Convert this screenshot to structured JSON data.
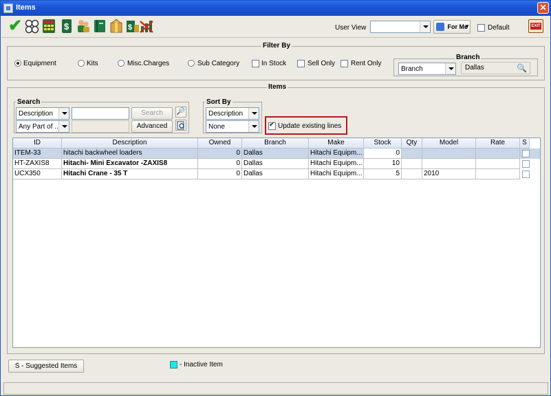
{
  "window": {
    "title": "Items"
  },
  "toolbar": {
    "icons": [
      "accept-icon",
      "kits-icon",
      "calculator-icon",
      "price-icon",
      "users-icon",
      "book-icon",
      "package-icon",
      "building-icon",
      "chart-icon"
    ],
    "user_view_label": "User View",
    "user_view_value": "",
    "for_me_label": "For Me",
    "default_label": "Default",
    "exit_label": "EXIT"
  },
  "filter": {
    "title": "Filter By",
    "options": [
      {
        "label": "Equipment",
        "type": "radio",
        "checked": true
      },
      {
        "label": "Kits",
        "type": "radio",
        "checked": false
      },
      {
        "label": "Misc.Charges",
        "type": "radio",
        "checked": false
      },
      {
        "label": "Sub Category",
        "type": "radio",
        "checked": false
      },
      {
        "label": "In Stock",
        "type": "check",
        "checked": false
      },
      {
        "label": "Sell Only",
        "type": "check",
        "checked": false
      },
      {
        "label": "Rent Only",
        "type": "check",
        "checked": false
      }
    ],
    "branch_title": "Branch",
    "branch_select": "Branch",
    "branch_value": "Dallas"
  },
  "items_panel": {
    "title": "Items"
  },
  "search": {
    "title": "Search",
    "field_select": "Description",
    "match_select": "Any Part of ...",
    "input_value": "",
    "search_button": "Search",
    "advanced_button": "Advanced"
  },
  "sort": {
    "title": "Sort By",
    "primary": "Description",
    "secondary": "None"
  },
  "update_existing_label": "Update existing lines",
  "table": {
    "columns": [
      "ID",
      "Description",
      "Owned",
      "Branch",
      "Make",
      "Stock",
      "Qty",
      "Model",
      "Rate",
      "S"
    ],
    "rows": [
      {
        "id": "ITEM-33",
        "description": "hitachi backwheel loaders",
        "owned": "0",
        "branch": "Dallas",
        "make": "Hitachi Equipm...",
        "stock": "0",
        "qty": "",
        "model": "",
        "rate": "",
        "selected": true,
        "bold": false
      },
      {
        "id": "HT-ZAXIS8",
        "description": "Hitachi- Mini Excavator -ZAXIS8",
        "owned": "0",
        "branch": "Dallas",
        "make": "Hitachi Equipm...",
        "stock": "10",
        "qty": "",
        "model": "",
        "rate": "",
        "selected": false,
        "bold": true
      },
      {
        "id": "UCX350",
        "description": "Hitachi Crane - 35 T",
        "owned": "0",
        "branch": "Dallas",
        "make": "Hitachi Equipm...",
        "stock": "5",
        "qty": "",
        "model": "2010",
        "rate": "",
        "selected": false,
        "bold": true
      }
    ]
  },
  "footer": {
    "suggested_button": "S - Suggested Items",
    "inactive_legend": "- Inactive Item",
    "inactive_color": "#22e5e5"
  },
  "colors": {
    "titlebar": "#1b55d5",
    "selected_row": "#c8d6e8",
    "highlight_border": "#b5171f"
  }
}
